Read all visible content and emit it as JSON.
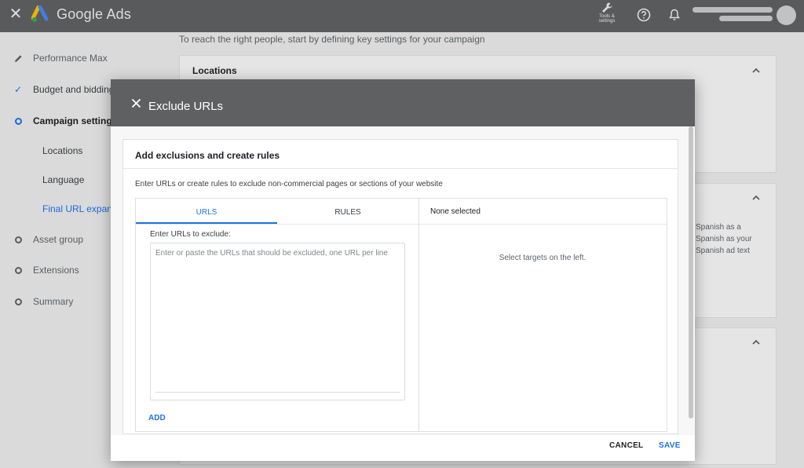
{
  "topbar": {
    "brand": "Google Ads",
    "tools_label_line1": "Tools &",
    "tools_label_line2": "settings"
  },
  "sidebar": {
    "items": [
      {
        "label": "Performance Max"
      },
      {
        "label": "Budget and bidding"
      },
      {
        "label": "Campaign settings"
      },
      {
        "label": "Locations"
      },
      {
        "label": "Language"
      },
      {
        "label": "Final URL expans"
      },
      {
        "label": "Asset group"
      },
      {
        "label": "Extensions"
      },
      {
        "label": "Summary"
      }
    ]
  },
  "background": {
    "intro": "To reach the right people, start by defining key settings for your campaign",
    "locations_card_title": "Locations",
    "side_text_line1": "Spanish as a",
    "side_text_line2": "Spanish as your",
    "side_text_line3": "Spanish ad text"
  },
  "modal": {
    "title": "Exclude URLs",
    "card_title": "Add exclusions and create rules",
    "description": "Enter URLs or create rules to exclude non-commercial pages or sections of your website",
    "tabs": [
      {
        "label": "URLS",
        "active": true
      },
      {
        "label": "RULES",
        "active": false
      }
    ],
    "enter_label": "Enter URLs to exclude:",
    "textarea_placeholder": "Enter or paste the URLs that should be excluded, one URL per line",
    "add_label": "ADD",
    "right_header": "None selected",
    "right_empty": "Select targets on the left.",
    "cancel_label": "CANCEL",
    "save_label": "SAVE"
  },
  "colors": {
    "accent": "#1a73e8",
    "header_bg": "#5f6062"
  }
}
